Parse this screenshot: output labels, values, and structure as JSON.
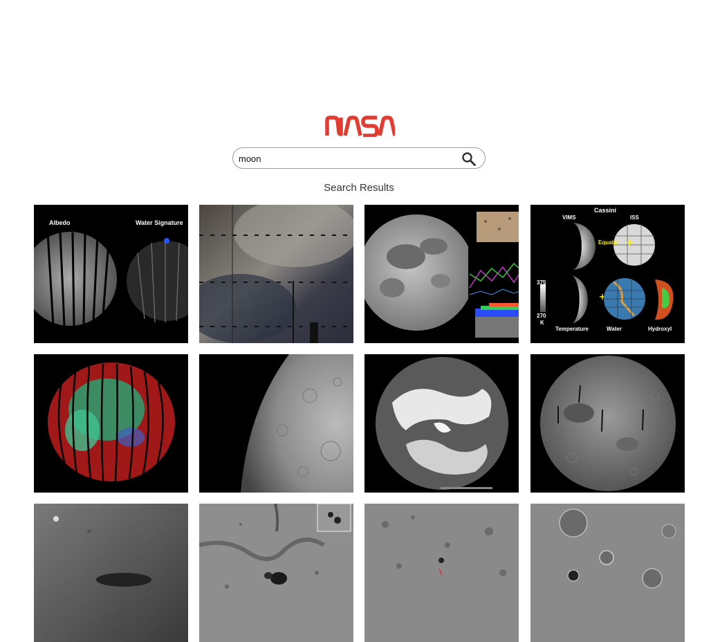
{
  "header": {
    "logo_text": "NASA",
    "logo_color": "#e03c31"
  },
  "search": {
    "value": "moon",
    "placeholder": ""
  },
  "results": {
    "title": "Search Results",
    "items": [
      {
        "id": 1,
        "labels": {
          "left": "Albedo",
          "right": "Water Signature"
        }
      },
      {
        "id": 2
      },
      {
        "id": 3
      },
      {
        "id": 4,
        "labels": {
          "title": "Cassini",
          "vims": "VIMS",
          "iss": "ISS",
          "equator": "Equator",
          "scale_top": "375",
          "scale_bottom": "270",
          "scale_unit": "K",
          "temperature": "Temperature",
          "water": "Water",
          "hydroxyl": "Hydroxyl"
        }
      },
      {
        "id": 5
      },
      {
        "id": 6
      },
      {
        "id": 7
      },
      {
        "id": 8
      },
      {
        "id": 9
      },
      {
        "id": 10
      },
      {
        "id": 11
      },
      {
        "id": 12
      }
    ]
  }
}
